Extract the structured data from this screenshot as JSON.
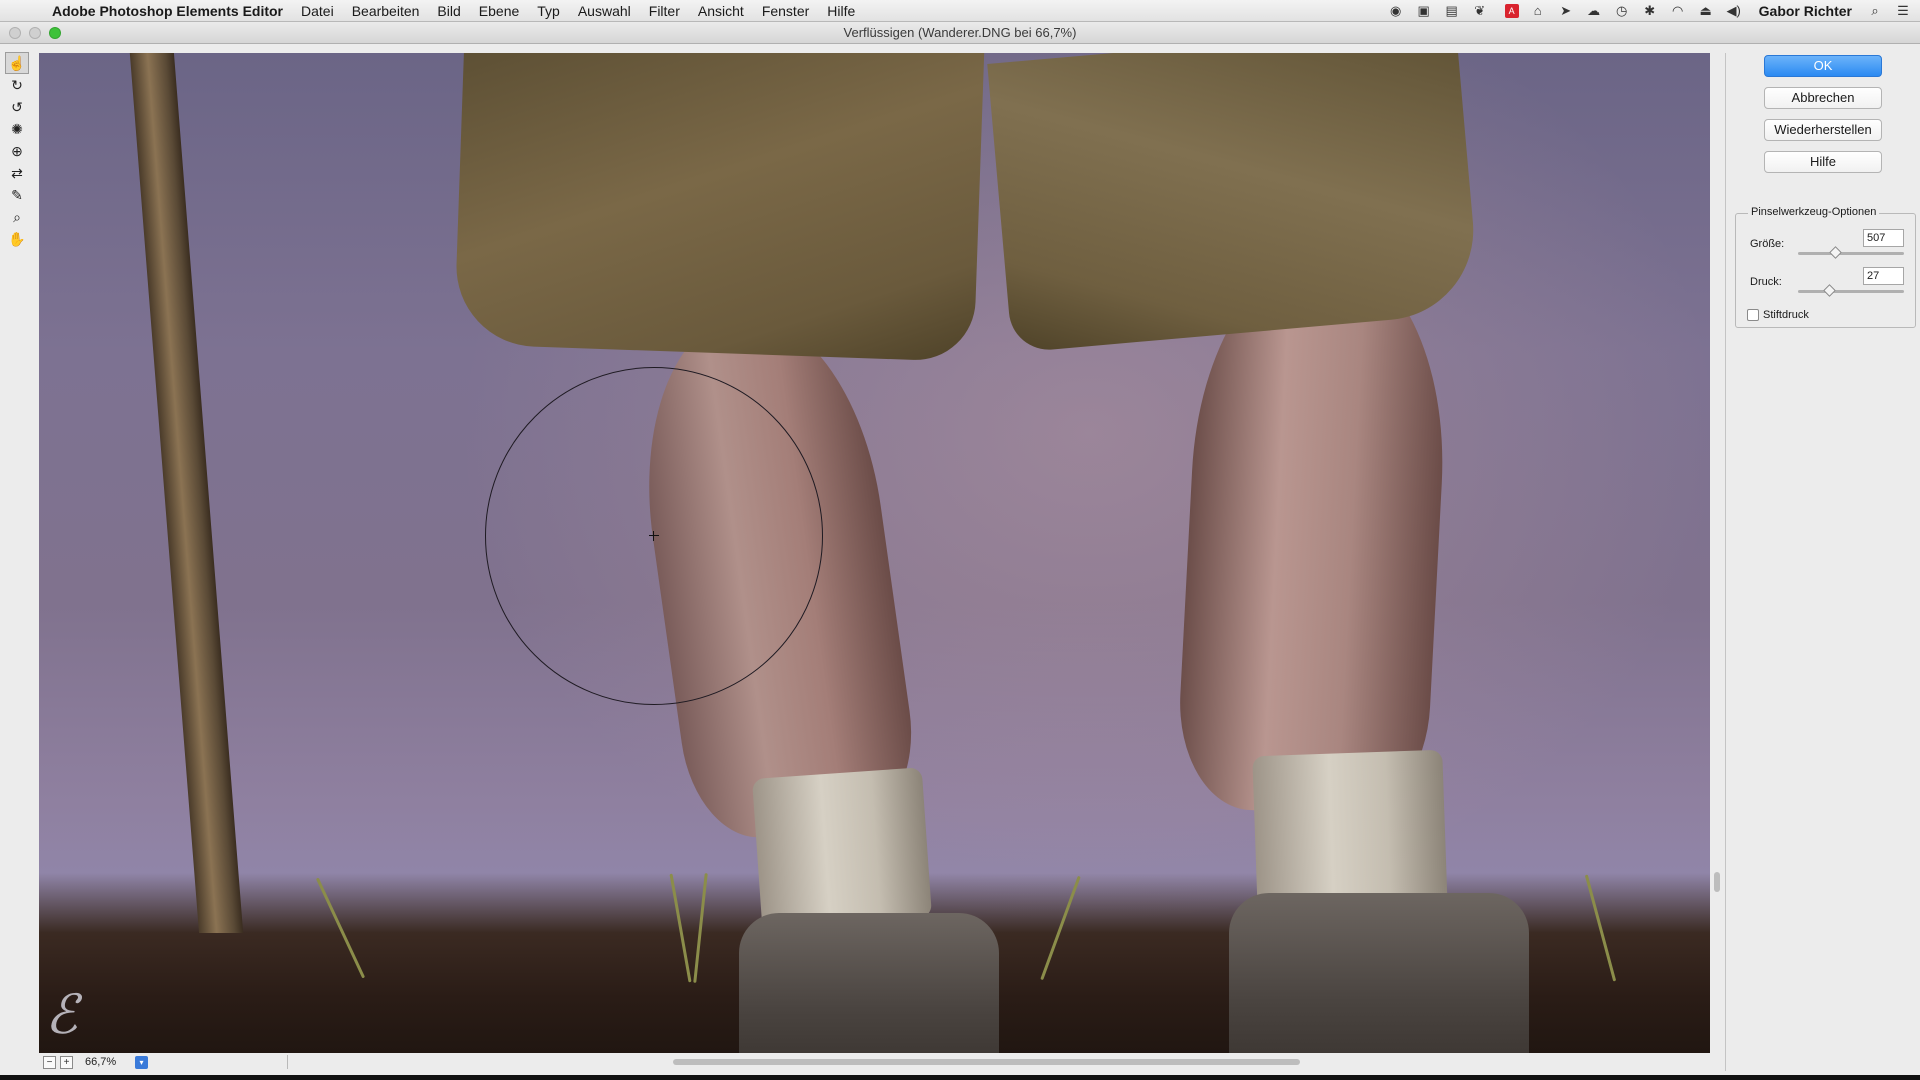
{
  "menubar": {
    "apple_glyph": "",
    "app_name": "Adobe Photoshop Elements Editor",
    "menus": [
      "Datei",
      "Bearbeiten",
      "Bild",
      "Ebene",
      "Typ",
      "Auswahl",
      "Filter",
      "Ansicht",
      "Fenster",
      "Hilfe"
    ],
    "user": "Gabor Richter",
    "tray_icons": [
      "record-icon",
      "display-icon",
      "messages-icon",
      "evernote-icon",
      "adobe-icon",
      "drive-icon",
      "forward-icon",
      "cloud-icon",
      "timemachine-icon",
      "bluetooth-icon",
      "wifi-icon",
      "eject-icon",
      "volume-icon"
    ]
  },
  "window": {
    "title": "Verflüssigen (Wanderer.DNG bei 66,7%)"
  },
  "tools": [
    {
      "name": "warp-tool-icon",
      "glyph": "☝",
      "active": true
    },
    {
      "name": "twirl-clockwise-tool-icon",
      "glyph": "↻",
      "active": false
    },
    {
      "name": "twirl-counterclockwise-tool-icon",
      "glyph": "↺",
      "active": false
    },
    {
      "name": "pucker-tool-icon",
      "glyph": "✺",
      "active": false
    },
    {
      "name": "bloat-tool-icon",
      "glyph": "⊕",
      "active": false
    },
    {
      "name": "shift-pixels-tool-icon",
      "glyph": "⇄",
      "active": false
    },
    {
      "name": "reconstruct-tool-icon",
      "glyph": "✎",
      "active": false
    },
    {
      "name": "zoom-tool-icon",
      "glyph": "⌕",
      "active": false
    },
    {
      "name": "hand-tool-icon",
      "glyph": "✋",
      "active": false
    }
  ],
  "buttons": {
    "ok": "OK",
    "cancel": "Abbrechen",
    "restore": "Wiederherstellen",
    "help": "Hilfe"
  },
  "brush_options": {
    "title": "Pinselwerkzeug-Optionen",
    "size_label": "Größe:",
    "size_value": "507",
    "pressure_label": "Druck:",
    "pressure_value": "27",
    "stylus_label": "Stiftdruck",
    "stylus_checked": false
  },
  "status": {
    "zoom_out": "−",
    "zoom_in": "+",
    "zoom_level": "66,7%",
    "zoom_dropdown": "▾"
  },
  "colors": {
    "accent_button": "#2b8af2",
    "zoom_button_green": "#3ec23a"
  }
}
